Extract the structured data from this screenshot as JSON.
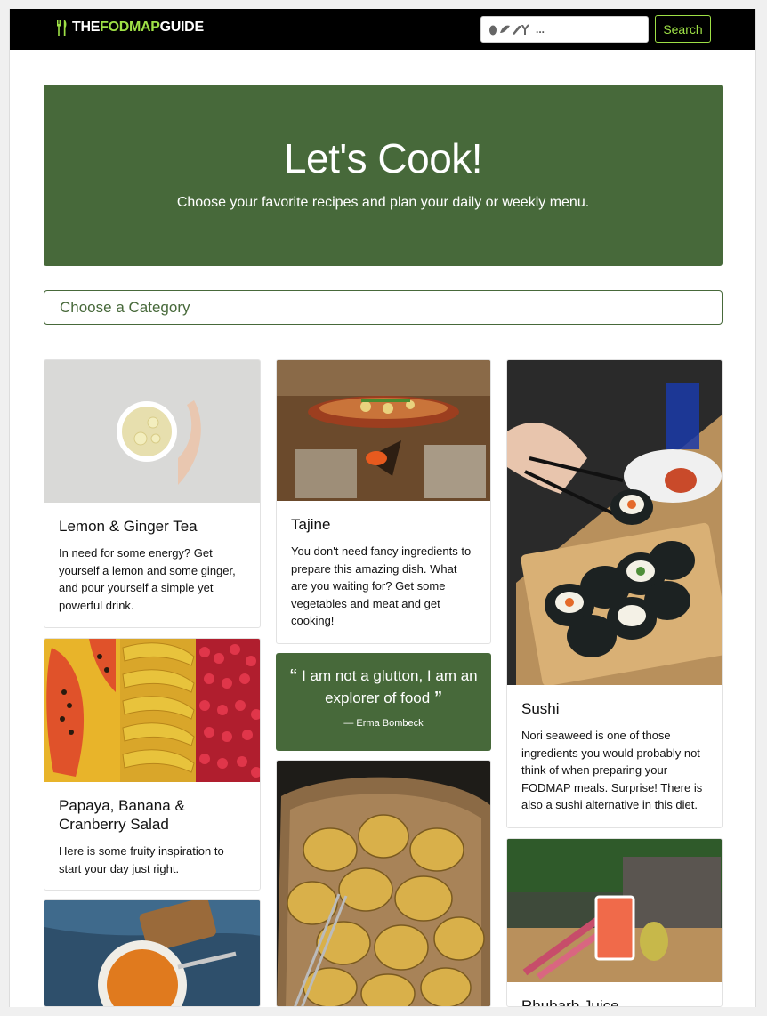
{
  "brand": {
    "part1": "THE",
    "part2": "FODMAP",
    "part3": "GUIDE"
  },
  "search": {
    "placeholder": "...",
    "button_label": "Search"
  },
  "hero": {
    "title": "Let's Cook!",
    "subtitle": "Choose your favorite recipes and plan your daily or weekly menu."
  },
  "category": {
    "label": "Choose a Category"
  },
  "quote": {
    "open_mark": "“",
    "text": "I am not a glutton, I am an explorer of food",
    "close_mark": "”",
    "author": "— Erma Bombeck"
  },
  "recipes": [
    {
      "title": "Lemon & Ginger Tea",
      "description": "In need for some energy? Get yourself a lemon and some ginger, and pour yourself a simple yet powerful drink."
    },
    {
      "title": "Tajine",
      "description": "You don't need fancy ingredients to prepare this amazing dish. What are you waiting for? Get some vegetables and meat and get cooking!"
    },
    {
      "title": "Sushi",
      "description": "Nori seaweed is one of those ingredients you would probably not think of when preparing your FODMAP meals. Surprise! There is also a sushi alternative in this diet."
    },
    {
      "title": "Papaya, Banana & Cranberry Salad",
      "description": "Here is some fruity inspiration to start your day just right."
    },
    {
      "title": "Rhubarb Juice",
      "description": ""
    },
    {
      "title": "",
      "description": ""
    }
  ],
  "colors": {
    "accent": "#47693a",
    "brand_green": "#9ee046",
    "navbar": "#000000"
  }
}
